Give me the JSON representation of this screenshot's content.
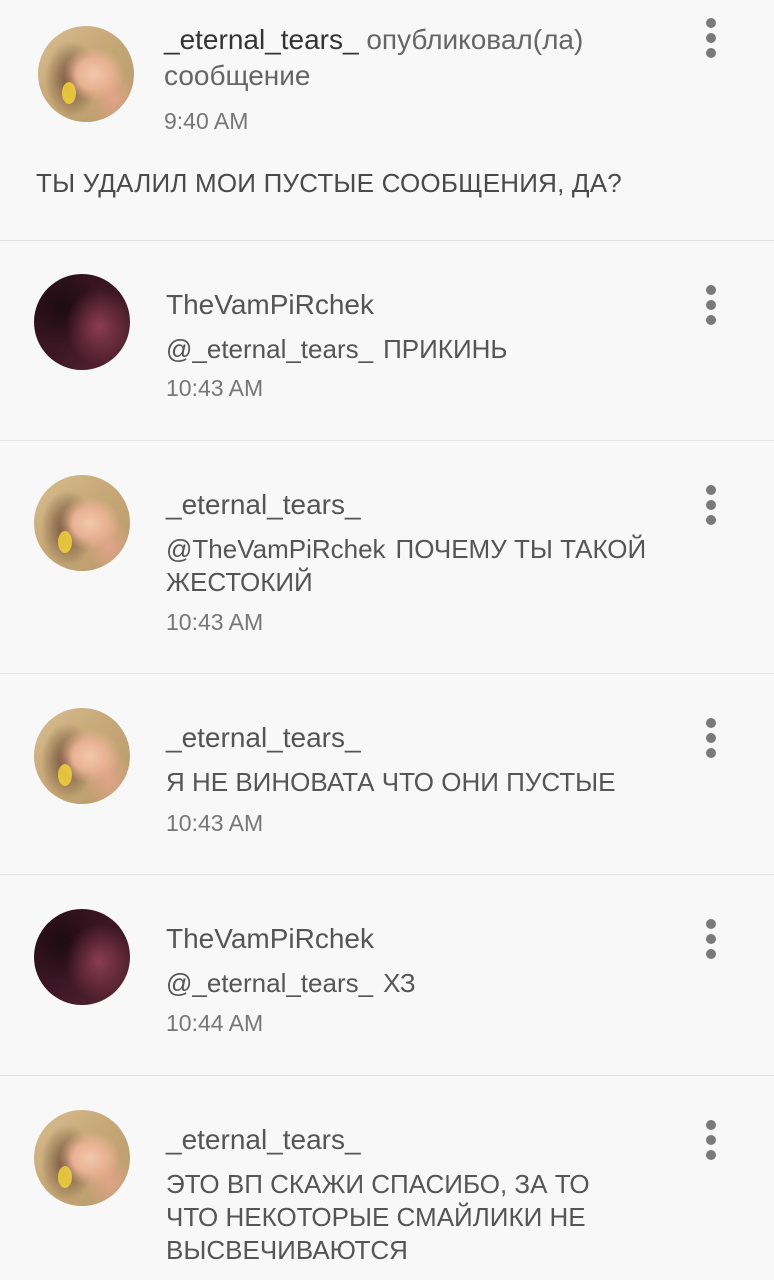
{
  "post": {
    "author": "_eternal_tears_",
    "action": "опубликовал(ла) сообщение",
    "time": "9:40 AM",
    "text": "ТЫ УДАЛИЛ МОИ ПУСТЫЕ СООБЩЕНИЯ, ДА?",
    "menu_icon": "more-vertical-icon"
  },
  "comments": [
    {
      "author": "TheVamPiRchek",
      "mention": "@_eternal_tears_",
      "text": "ПРИКИНЬ",
      "time": "10:43 AM"
    },
    {
      "author": "_eternal_tears_",
      "mention": "@TheVamPiRchek",
      "text": "ПОЧЕМУ ТЫ ТАКОЙ ЖЕСТОКИЙ",
      "time": "10:43 AM"
    },
    {
      "author": "_eternal_tears_",
      "mention": "",
      "text": "Я НЕ ВИНОВАТА ЧТО ОНИ ПУСТЫЕ",
      "time": "10:43 AM"
    },
    {
      "author": "TheVamPiRchek",
      "mention": "@_eternal_tears_",
      "text": "ХЗ",
      "time": "10:44 AM"
    },
    {
      "author": "_eternal_tears_",
      "mention": "",
      "text": "ЭТО ВП СКАЖИ СПАСИБО, ЗА ТО ЧТО НЕКОТОРЫЕ СМАЙЛИКИ НЕ ВЫСВЕЧИВАЮТСЯ",
      "time": ""
    }
  ]
}
